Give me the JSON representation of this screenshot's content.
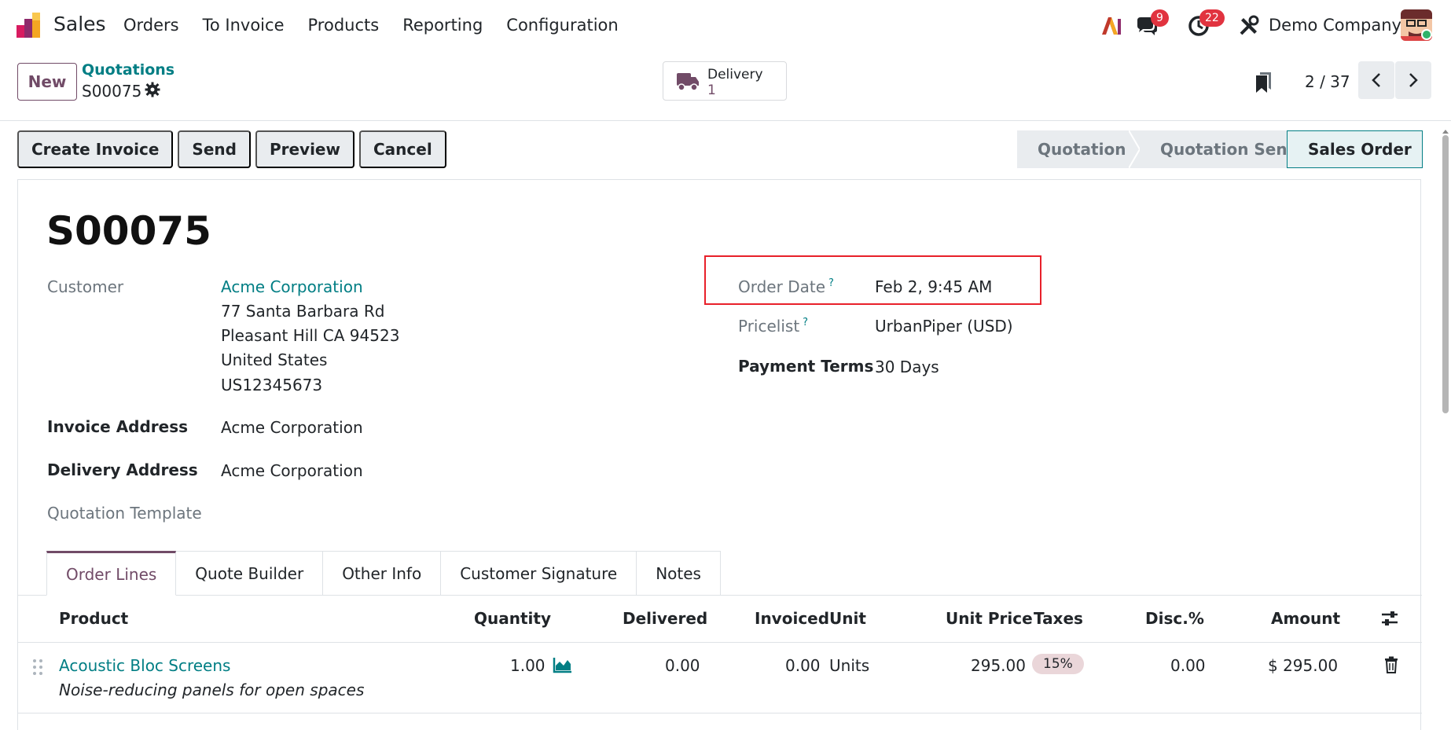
{
  "navbar": {
    "app_name": "Sales",
    "menu": [
      "Orders",
      "To Invoice",
      "Products",
      "Reporting",
      "Configuration"
    ],
    "messages_count": "9",
    "activities_count": "22",
    "company": "Demo Company"
  },
  "control": {
    "new_label": "New",
    "breadcrumb": "Quotations",
    "record": "S00075",
    "delivery_label": "Delivery",
    "delivery_count": "1",
    "pager": "2 / 37"
  },
  "actions": [
    "Create Invoice",
    "Send",
    "Preview",
    "Cancel"
  ],
  "status": {
    "stages": [
      "Quotation",
      "Quotation Sent",
      "Sales Order"
    ],
    "active": "Sales Order"
  },
  "form": {
    "title": "S00075",
    "customer_label": "Customer",
    "customer_name": "Acme Corporation",
    "customer_address": [
      "77 Santa Barbara Rd",
      "Pleasant Hill CA 94523",
      "United States",
      "US12345673"
    ],
    "invoice_address_label": "Invoice Address",
    "invoice_address": "Acme Corporation",
    "delivery_address_label": "Delivery Address",
    "delivery_address": "Acme Corporation",
    "quotation_template_label": "Quotation Template",
    "order_date_label": "Order Date",
    "order_date": "Feb 2, 9:45 AM",
    "pricelist_label": "Pricelist",
    "pricelist": "UrbanPiper (USD)",
    "payment_terms_label": "Payment Terms",
    "payment_terms": "30 Days",
    "help_mark": "?"
  },
  "tabs": [
    "Order Lines",
    "Quote Builder",
    "Other Info",
    "Customer Signature",
    "Notes"
  ],
  "table": {
    "headers": {
      "product": "Product",
      "quantity": "Quantity",
      "delivered": "Delivered",
      "invoiced": "Invoiced",
      "unit": "Unit",
      "unit_price": "Unit Price",
      "taxes": "Taxes",
      "disc": "Disc.%",
      "amount": "Amount"
    },
    "rows": [
      {
        "product": "Acoustic Bloc Screens",
        "description": "Noise-reducing panels for open spaces",
        "quantity": "1.00",
        "delivered": "0.00",
        "invoiced": "0.00",
        "unit": "Units",
        "unit_price": "295.00",
        "taxes": "15%",
        "disc": "0.00",
        "amount": "$ 295.00"
      }
    ]
  },
  "colors": {
    "brand": "#714b67",
    "link": "#017e84",
    "highlight": "#e8202a",
    "badge": "#e1333f"
  }
}
